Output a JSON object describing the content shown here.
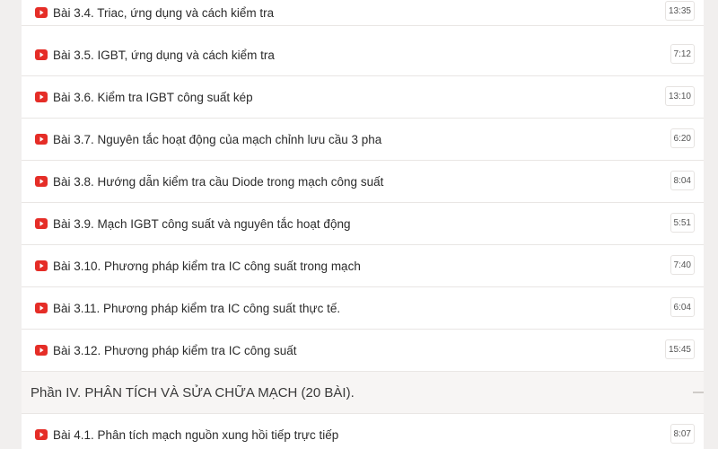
{
  "lessons_top": [
    {
      "title": "Bài 3.4. Triac, ứng dụng và cách kiểm tra",
      "duration": "13:35"
    },
    {
      "title": "Bài 3.5. IGBT, ứng dụng và cách kiểm tra",
      "duration": "7:12"
    },
    {
      "title": "Bài 3.6. Kiểm tra IGBT công suất kép",
      "duration": "13:10"
    },
    {
      "title": "Bài 3.7. Nguyên tắc hoạt động của mạch chỉnh lưu cầu 3 pha",
      "duration": "6:20"
    },
    {
      "title": "Bài 3.8. Hướng dẫn kiểm tra cầu Diode trong mạch công suất",
      "duration": "8:04"
    },
    {
      "title": "Bài 3.9. Mạch IGBT công suất và nguyên tắc hoạt động",
      "duration": "5:51"
    },
    {
      "title": "Bài 3.10. Phương pháp kiểm tra IC công suất trong mạch",
      "duration": "7:40"
    },
    {
      "title": "Bài 3.11. Phương pháp kiểm tra IC công suất thực tế.",
      "duration": "6:04"
    },
    {
      "title": "Bài 3.12. Phương pháp kiểm tra IC công suất",
      "duration": "15:45"
    }
  ],
  "section": {
    "title": "Phần IV. PHÂN TÍCH VÀ SỬA CHỮA MẠCH (20 BÀI)."
  },
  "lessons_bottom": [
    {
      "title": "Bài 4.1. Phân tích mạch nguồn xung hồi tiếp trực tiếp",
      "duration": "8:07"
    }
  ],
  "colors": {
    "youtube_red": "#e52d27"
  }
}
